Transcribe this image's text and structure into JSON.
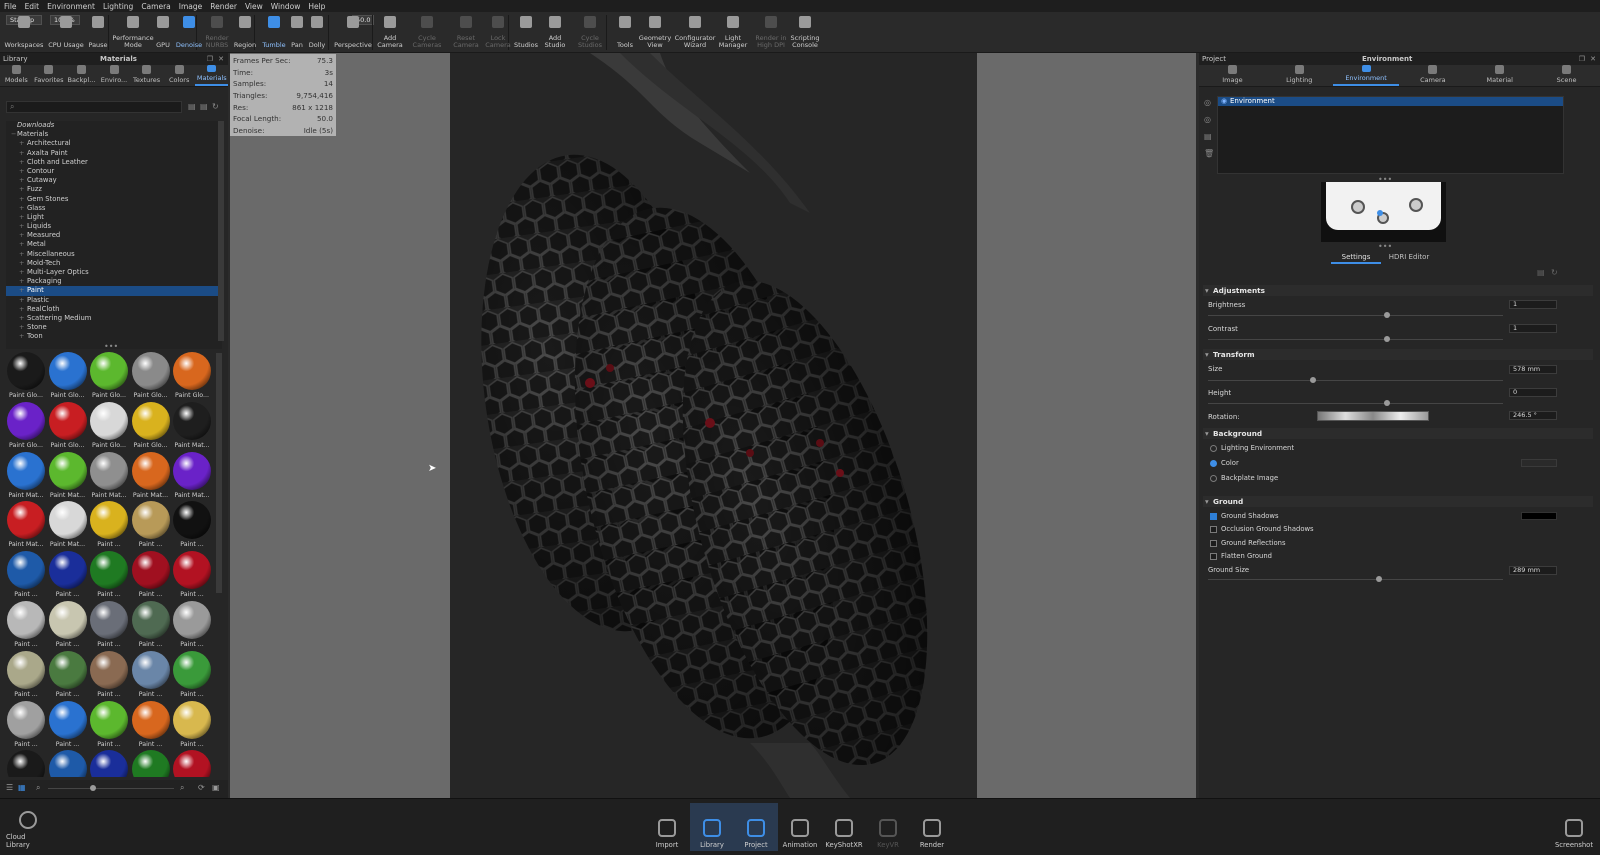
{
  "menu": [
    "File",
    "Edit",
    "Environment",
    "Lighting",
    "Camera",
    "Image",
    "Render",
    "View",
    "Window",
    "Help"
  ],
  "toolbar": {
    "workspace_value": "Startup",
    "cpu_value": "100 %",
    "focal_value": "50.0",
    "items": [
      {
        "label": "Workspaces",
        "state": "normal"
      },
      {
        "label": "CPU Usage",
        "state": "normal"
      },
      {
        "label": "Pause",
        "state": "normal"
      },
      {
        "label": "Performance\nMode",
        "state": "normal"
      },
      {
        "label": "GPU",
        "state": "normal"
      },
      {
        "label": "Denoise",
        "state": "active"
      },
      {
        "label": "Render\nNURBS",
        "state": "disabled"
      },
      {
        "label": "Region",
        "state": "normal"
      },
      {
        "label": "Tumble",
        "state": "active"
      },
      {
        "label": "Pan",
        "state": "normal"
      },
      {
        "label": "Dolly",
        "state": "normal"
      },
      {
        "label": "Perspective",
        "state": "normal"
      },
      {
        "label": "Add\nCamera",
        "state": "normal"
      },
      {
        "label": "Cycle\nCameras",
        "state": "disabled"
      },
      {
        "label": "Reset\nCamera",
        "state": "disabled"
      },
      {
        "label": "Lock\nCamera",
        "state": "disabled"
      },
      {
        "label": "Studios",
        "state": "normal"
      },
      {
        "label": "Add\nStudio",
        "state": "normal"
      },
      {
        "label": "Cycle\nStudios",
        "state": "disabled"
      },
      {
        "label": "Tools",
        "state": "normal"
      },
      {
        "label": "Geometry\nView",
        "state": "normal"
      },
      {
        "label": "Configurator\nWizard",
        "state": "normal"
      },
      {
        "label": "Light\nManager",
        "state": "normal"
      },
      {
        "label": "Render in\nHigh DPI",
        "state": "disabled"
      },
      {
        "label": "Scripting\nConsole",
        "state": "normal"
      }
    ]
  },
  "library": {
    "title": "Library",
    "panel_title": "Materials",
    "tabs": [
      "Models",
      "Favorites",
      "Backpl...",
      "Enviro...",
      "Textures",
      "Colors",
      "Materials"
    ],
    "active_tab": "Materials",
    "tree": [
      {
        "label": "Downloads",
        "kind": "root"
      },
      {
        "label": "Materials",
        "kind": "group"
      },
      {
        "label": "Architectural"
      },
      {
        "label": "Axalta Paint"
      },
      {
        "label": "Cloth and Leather"
      },
      {
        "label": "Contour"
      },
      {
        "label": "Cutaway"
      },
      {
        "label": "Fuzz"
      },
      {
        "label": "Gem Stones"
      },
      {
        "label": "Glass"
      },
      {
        "label": "Light"
      },
      {
        "label": "Liquids"
      },
      {
        "label": "Measured"
      },
      {
        "label": "Metal"
      },
      {
        "label": "Miscellaneous"
      },
      {
        "label": "Mold-Tech"
      },
      {
        "label": "Multi-Layer Optics"
      },
      {
        "label": "Packaging"
      },
      {
        "label": "Paint",
        "selected": true
      },
      {
        "label": "Plastic"
      },
      {
        "label": "RealCloth"
      },
      {
        "label": "Scattering Medium"
      },
      {
        "label": "Stone"
      },
      {
        "label": "Toon"
      }
    ],
    "swatches": [
      {
        "label": "Paint Glo...",
        "color": "#1a1a1a"
      },
      {
        "label": "Paint Glo...",
        "color": "#2a72d0"
      },
      {
        "label": "Paint Glo...",
        "color": "#5cb82e"
      },
      {
        "label": "Paint Glo...",
        "color": "#8a8a8a"
      },
      {
        "label": "Paint Glo...",
        "color": "#d8671e"
      },
      {
        "label": "Paint Glo...",
        "color": "#6a22c8"
      },
      {
        "label": "Paint Glo...",
        "color": "#c81e22"
      },
      {
        "label": "Paint Glo...",
        "color": "#d8d8d8"
      },
      {
        "label": "Paint Glo...",
        "color": "#d9b21e"
      },
      {
        "label": "Paint Mat...",
        "color": "#1e1e1e"
      },
      {
        "label": "Paint Mat...",
        "color": "#2a72d0"
      },
      {
        "label": "Paint Mat...",
        "color": "#5cb82e"
      },
      {
        "label": "Paint Mat...",
        "color": "#8f8f8f"
      },
      {
        "label": "Paint Mat...",
        "color": "#d8671e"
      },
      {
        "label": "Paint Mat...",
        "color": "#6a22c8"
      },
      {
        "label": "Paint Mat...",
        "color": "#c81e22"
      },
      {
        "label": "Paint Mat...",
        "color": "#d8d8d8"
      },
      {
        "label": "Paint ...",
        "color": "#d9b21e"
      },
      {
        "label": "Paint ...",
        "color": "#b89a58"
      },
      {
        "label": "Paint ...",
        "color": "#111111"
      },
      {
        "label": "Paint ...",
        "color": "#1e5aa8"
      },
      {
        "label": "Paint ...",
        "color": "#1a2e9a"
      },
      {
        "label": "Paint ...",
        "color": "#1f7a22"
      },
      {
        "label": "Paint ...",
        "color": "#a01020"
      },
      {
        "label": "Paint ...",
        "color": "#b21222"
      },
      {
        "label": "Paint ...",
        "color": "#b8b8b8"
      },
      {
        "label": "Paint ...",
        "color": "#c8c6b0"
      },
      {
        "label": "Paint ...",
        "color": "#6a6e78"
      },
      {
        "label": "Paint ...",
        "color": "#4f6a52"
      },
      {
        "label": "Paint ...",
        "color": "#9a9a9a"
      },
      {
        "label": "Paint ...",
        "color": "#aaa88a"
      },
      {
        "label": "Paint ...",
        "color": "#4a7a40"
      },
      {
        "label": "Paint ...",
        "color": "#8a6a52"
      },
      {
        "label": "Paint ...",
        "color": "#6a86a8"
      },
      {
        "label": "Paint ...",
        "color": "#3a9a3a"
      },
      {
        "label": "Paint ...",
        "color": "#a0a0a0"
      },
      {
        "label": "Paint ...",
        "color": "#2a72d0"
      },
      {
        "label": "Paint ...",
        "color": "#5cb82e"
      },
      {
        "label": "Paint ...",
        "color": "#d8671e"
      },
      {
        "label": "Paint ...",
        "color": "#d8b84e"
      },
      {
        "label": "",
        "color": "#1a1a1a"
      },
      {
        "label": "",
        "color": "#1e5aa8"
      },
      {
        "label": "",
        "color": "#1a2e9a"
      },
      {
        "label": "",
        "color": "#1f7a22"
      },
      {
        "label": "",
        "color": "#b21222"
      }
    ]
  },
  "hud": [
    {
      "k": "Frames Per Sec:",
      "v": "75.3"
    },
    {
      "k": "Time:",
      "v": "3s"
    },
    {
      "k": "Samples:",
      "v": "14"
    },
    {
      "k": "Triangles:",
      "v": "9,754,416"
    },
    {
      "k": "Res:",
      "v": "861 x 1218"
    },
    {
      "k": "Focal Length:",
      "v": "50.0"
    },
    {
      "k": "Denoise:",
      "v": "Idle (5s)"
    }
  ],
  "project": {
    "title": "Project",
    "panel_title": "Environment",
    "tabs": [
      "Image",
      "Lighting",
      "Environment",
      "Camera",
      "Material",
      "Scene"
    ],
    "active_tab": "Environment",
    "env_item": "Environment",
    "subtabs": [
      "Settings",
      "HDRI Editor"
    ],
    "adjustments": {
      "title": "Adjustments",
      "brightness_label": "Brightness",
      "brightness": "1",
      "contrast_label": "Contrast",
      "contrast": "1"
    },
    "transform": {
      "title": "Transform",
      "size_label": "Size",
      "size": "578 mm",
      "height_label": "Height",
      "height": "0",
      "rotation_label": "Rotation:",
      "rotation": "246.5 °"
    },
    "background": {
      "title": "Background",
      "options": [
        "Lighting Environment",
        "Color",
        "Backplate Image"
      ],
      "selected": "Color"
    },
    "ground": {
      "title": "Ground",
      "checks": [
        {
          "label": "Ground Shadows",
          "on": true
        },
        {
          "label": "Occlusion Ground Shadows",
          "on": false
        },
        {
          "label": "Ground Reflections",
          "on": false
        },
        {
          "label": "Flatten Ground",
          "on": false
        }
      ],
      "size_label": "Ground Size",
      "size": "289 mm"
    }
  },
  "bottom": {
    "cloud_label": "Cloud Library",
    "items": [
      {
        "label": "Import",
        "state": "normal"
      },
      {
        "label": "Library",
        "state": "active"
      },
      {
        "label": "Project",
        "state": "active"
      },
      {
        "label": "Animation",
        "state": "normal"
      },
      {
        "label": "KeyShotXR",
        "state": "normal"
      },
      {
        "label": "KeyVR",
        "state": "disabled"
      },
      {
        "label": "Render",
        "state": "normal"
      }
    ],
    "screenshot_label": "Screenshot"
  },
  "colors": {
    "accent": "#3e8ee6",
    "selection": "#1b4c86"
  }
}
